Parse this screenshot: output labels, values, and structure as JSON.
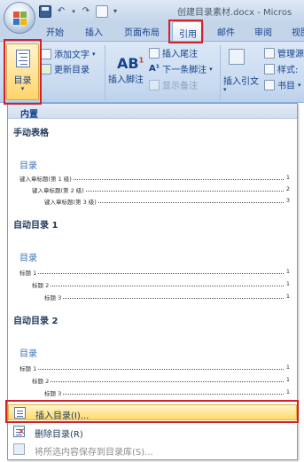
{
  "window": {
    "title": "创建目录素材.docx - Micros"
  },
  "quick_access": {
    "icons": [
      "save-icon",
      "undo-icon",
      "redo-icon",
      "quick-print-icon",
      "customize-qat-icon"
    ]
  },
  "tabs": [
    {
      "label": "开始",
      "active": false
    },
    {
      "label": "插入",
      "active": false
    },
    {
      "label": "页面布局",
      "active": false
    },
    {
      "label": "引用",
      "active": true
    },
    {
      "label": "邮件",
      "active": false
    },
    {
      "label": "审阅",
      "active": false
    },
    {
      "label": "视图",
      "active": false
    }
  ],
  "ribbon": {
    "toc_group": {
      "button_label": "目录",
      "add_text": "添加文字",
      "update_toc": "更新目录"
    },
    "footnotes_group": {
      "ab_label": "AB",
      "ab_superscript": "1",
      "insert_footnote": "插入脚注",
      "insert_endnote": "插入尾注",
      "next_footnote": "下一条脚注",
      "show_notes": "显示备注"
    },
    "citations_group": {
      "insert_citation": "插入引文",
      "manage_sources": "管理源",
      "style": "样式:",
      "bibliography": "书目"
    }
  },
  "gallery": {
    "header": "内置",
    "sections": [
      {
        "title": "手动表格",
        "preview_heading": "目录",
        "rows": [
          {
            "text": "键入章标题(第 1 级)",
            "page": "1",
            "indent": 0
          },
          {
            "text": "键入章标题(第 2 级)",
            "page": "2",
            "indent": 1
          },
          {
            "text": "键入章标题(第 3 级)",
            "page": "3",
            "indent": 2
          }
        ]
      },
      {
        "title": "自动目录 1",
        "preview_heading": "目录",
        "rows": [
          {
            "text": "标题 1",
            "page": "1",
            "indent": 0
          },
          {
            "text": "标题 2",
            "page": "1",
            "indent": 1
          },
          {
            "text": "标题 3",
            "page": "1",
            "indent": 2
          }
        ]
      },
      {
        "title": "自动目录 2",
        "preview_heading": "目录",
        "rows": [
          {
            "text": "标题 1",
            "page": "1",
            "indent": 0
          },
          {
            "text": "标题 2",
            "page": "1",
            "indent": 1
          },
          {
            "text": "标题 3",
            "page": "1",
            "indent": 2
          }
        ]
      }
    ],
    "menu": {
      "insert_toc": "插入目录(I)...",
      "remove_toc": "删除目录(R)",
      "save_selection": "将所选内容保存到目录库(S)..."
    }
  },
  "colors": {
    "highlight_border": "#d2232a",
    "ribbon_text": "#15428b",
    "hover": "#ffd96b"
  }
}
